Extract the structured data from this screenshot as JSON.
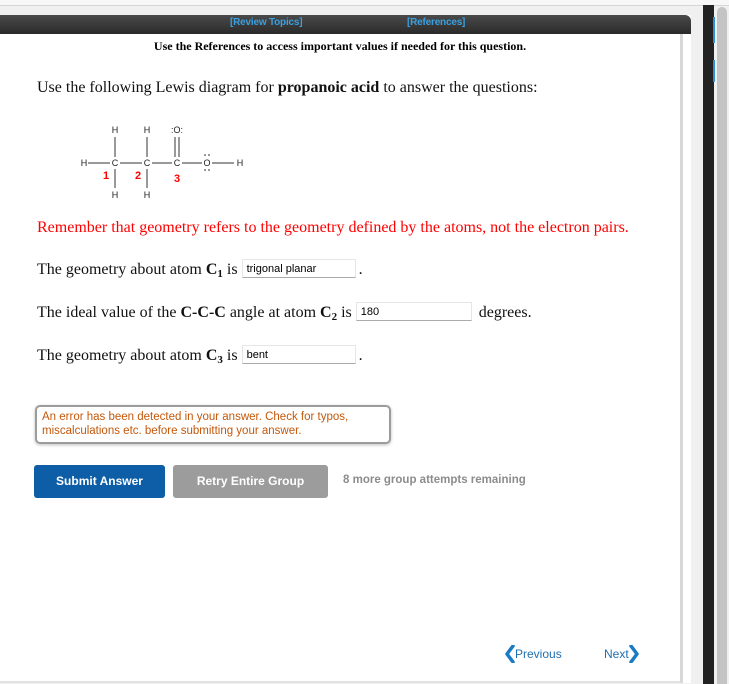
{
  "header": {
    "review_topics": "[Review Topics]",
    "references": "[References]",
    "note": "Use the References to access important values if needed for this question."
  },
  "question": {
    "intro_pre": "Use the following Lewis diagram for ",
    "compound": "propanoic acid",
    "intro_post": " to answer the questions:",
    "reminder": "Remember that geometry refers to the geometry defined by the atoms, not the electron pairs.",
    "q1": {
      "pre": "The geometry about atom ",
      "atom": "C",
      "sub": "1",
      "post": " is",
      "answer": "trigonal planar",
      "suffix": "."
    },
    "q2": {
      "pre": "The ideal value of the ",
      "bold": "C-C-C",
      "mid": " angle at atom ",
      "atom": "C",
      "sub": "2",
      "post": " is",
      "answer": "180",
      "suffix": "degrees."
    },
    "q3": {
      "pre": "The geometry about atom ",
      "atom": "C",
      "sub": "3",
      "post": " is",
      "answer": "bent",
      "suffix": "."
    }
  },
  "lewis": {
    "atoms": {
      "H": "H",
      "C": "C",
      "O_double": ":O:",
      "O": "O"
    },
    "labels": [
      "1",
      "2",
      "3"
    ],
    "label_color": "#ff0000"
  },
  "error_message": "An error has been detected in your answer. Check for typos, miscalculations etc. before submitting your answer.",
  "buttons": {
    "submit": "Submit Answer",
    "retry": "Retry Entire Group"
  },
  "attempts_text": "8 more group attempts remaining",
  "nav": {
    "previous": "Previous",
    "next": "Next"
  },
  "colors": {
    "link": "#3aa0e0",
    "reminder": "#ff0000",
    "error_text": "#c4580a",
    "submit_bg": "#0d5ea6",
    "retry_bg": "#9c9c9c",
    "nav": "#1f6fb0"
  }
}
